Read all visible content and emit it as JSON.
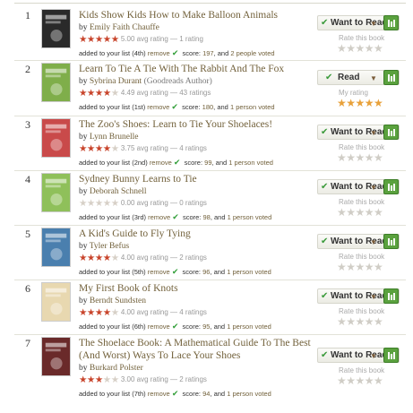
{
  "list": [
    {
      "rank": "1",
      "title": "Kids Show Kids How to Make Balloon Animals",
      "by": "by",
      "author": "Emily Faith Chauffe",
      "author_role": "",
      "avg_rating_text": "5.00 avg rating — 1 rating",
      "avg_stars": 5,
      "added": "added to your list (4th)",
      "remove": "remove",
      "score_label": "score:",
      "score": "197",
      "voters_and": ", and",
      "voters": "2 people voted",
      "shelf_button": "Want to Read",
      "rate_label": "Rate this book",
      "my_stars": 0,
      "cover_color": "#2a2a2a"
    },
    {
      "rank": "2",
      "title": "Learn To Tie A Tie With The Rabbit And The Fox",
      "by": "by",
      "author": "Sybrina Durant",
      "author_role": "(Goodreads Author)",
      "avg_rating_text": "4.49 avg rating — 43 ratings",
      "avg_stars": 4.5,
      "added": "added to your list (1st)",
      "remove": "remove",
      "score_label": "score:",
      "score": "180",
      "voters_and": ", and",
      "voters": "1 person voted",
      "shelf_button": "Read",
      "rate_label": "My rating",
      "my_stars": 5,
      "cover_color": "#7fae4a"
    },
    {
      "rank": "3",
      "title": "The Zoo's Shoes: Learn to Tie Your Shoelaces!",
      "by": "by",
      "author": "Lynn Brunelle",
      "author_role": "",
      "avg_rating_text": "3.75 avg rating — 4 ratings",
      "avg_stars": 3.75,
      "added": "added to your list (2nd)",
      "remove": "remove",
      "score_label": "score:",
      "score": "99",
      "voters_and": ", and",
      "voters": "1 person voted",
      "shelf_button": "Want to Read",
      "rate_label": "Rate this book",
      "my_stars": 0,
      "cover_color": "#c94a4a"
    },
    {
      "rank": "4",
      "title": "Sydney Bunny Learns to Tie",
      "by": "by",
      "author": "Deborah Schnell",
      "author_role": "",
      "avg_rating_text": "0.00 avg rating — 0 ratings",
      "avg_stars": 0,
      "added": "added to your list (3rd)",
      "remove": "remove",
      "score_label": "score:",
      "score": "98",
      "voters_and": ", and",
      "voters": "1 person voted",
      "shelf_button": "Want to Read",
      "rate_label": "Rate this book",
      "my_stars": 0,
      "cover_color": "#8fc05a"
    },
    {
      "rank": "5",
      "title": "A Kid's Guide to Fly Tying",
      "by": "by",
      "author": "Tyler Befus",
      "author_role": "",
      "avg_rating_text": "4.00 avg rating — 2 ratings",
      "avg_stars": 4,
      "added": "added to your list (5th)",
      "remove": "remove",
      "score_label": "score:",
      "score": "96",
      "voters_and": ", and",
      "voters": "1 person voted",
      "shelf_button": "Want to Read",
      "rate_label": "Rate this book",
      "my_stars": 0,
      "cover_color": "#4a7fae"
    },
    {
      "rank": "6",
      "title": "My First Book of Knots",
      "by": "by",
      "author": "Berndt Sundsten",
      "author_role": "",
      "avg_rating_text": "4.00 avg rating — 4 ratings",
      "avg_stars": 4,
      "added": "added to your list (6th)",
      "remove": "remove",
      "score_label": "score:",
      "score": "95",
      "voters_and": ", and",
      "voters": "1 person voted",
      "shelf_button": "Want to Read",
      "rate_label": "Rate this book",
      "my_stars": 0,
      "cover_color": "#e8d8b0"
    },
    {
      "rank": "7",
      "title": "The Shoelace Book: A Mathematical Guide To The Best (And Worst) Ways To Lace Your Shoes",
      "by": "by",
      "author": "Burkard Polster",
      "author_role": "",
      "avg_rating_text": "3.00 avg rating — 2 ratings",
      "avg_stars": 3,
      "added": "added to your list (7th)",
      "remove": "remove",
      "score_label": "score:",
      "score": "94",
      "voters_and": ", and",
      "voters": "1 person voted",
      "shelf_button": "Want to Read",
      "rate_label": "Rate this book",
      "my_stars": 0,
      "cover_color": "#6a2a2a"
    }
  ],
  "colors": {
    "link": "#72613b",
    "star_filled": "#c8442b",
    "star_empty": "#d7d0c7",
    "check_green": "#35a03c",
    "shelf_green": "#5aa13e",
    "my_rating_star": "#e8a13a"
  },
  "icons": {
    "remove_check": "check-icon",
    "shelf_button_check": "check-icon",
    "shelf_dropdown": "triangle-down-icon",
    "shelf_menu": "bookshelf-icon",
    "rate_stars": "star-icon"
  }
}
